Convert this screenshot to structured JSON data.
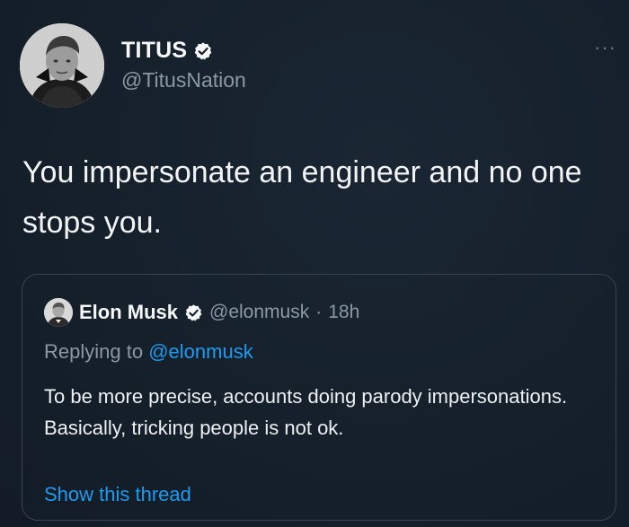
{
  "author": {
    "display_name": "TITUS",
    "handle": "@TitusNation",
    "verified_icon": "verified-badge-icon"
  },
  "more_label": "···",
  "tweet": {
    "text": "You impersonate an engineer and no one stops you."
  },
  "quoted": {
    "display_name": "Elon Musk",
    "handle": "@elonmusk",
    "separator": "·",
    "time": "18h",
    "replying_prefix": "Replying to",
    "replying_handle": "@elonmusk",
    "text": "To be more precise, accounts doing parody impersonations. Basically, tricking people is not ok.",
    "show_thread": "Show this thread"
  },
  "colors": {
    "background": "#15202b",
    "link": "#1d9bf0",
    "secondary_text": "#8b98a5",
    "border": "#38444d"
  }
}
